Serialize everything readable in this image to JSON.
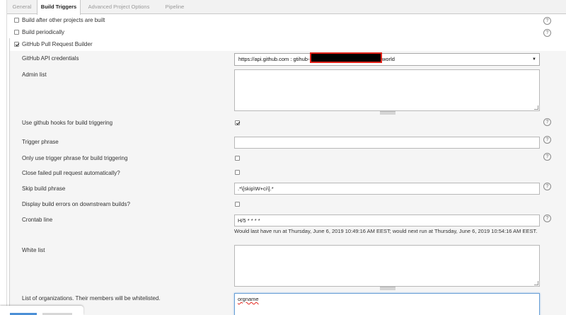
{
  "tabs": [
    {
      "label": "General"
    },
    {
      "label": "Build Triggers"
    },
    {
      "label": "Advanced Project Options"
    },
    {
      "label": "Pipeline"
    }
  ],
  "triggers": {
    "build_after_other": {
      "label": "Build after other projects are built",
      "checked": false
    },
    "build_periodically": {
      "label": "Build periodically",
      "checked": false
    },
    "ghprb": {
      "label": "GitHub Pull Request Builder",
      "checked": true
    }
  },
  "fields": {
    "api_credentials": {
      "label": "GitHub API credentials",
      "value_prefix": "https://api.github.com : gtihub-",
      "value_suffix": "world"
    },
    "admin_list": {
      "label": "Admin list",
      "value": ""
    },
    "use_hooks": {
      "label": "Use github hooks for build triggering",
      "checked": true
    },
    "trigger_phrase": {
      "label": "Trigger phrase",
      "value": ""
    },
    "only_trigger_phrase": {
      "label": "Only use trigger phrase for build triggering",
      "checked": false
    },
    "close_failed": {
      "label": "Close failed pull request automatically?",
      "checked": false
    },
    "skip_build_phrase": {
      "label": "Skip build phrase",
      "value": ".*\\[skip\\W+ci\\].*"
    },
    "display_errors": {
      "label": "Display build errors on downstream builds?",
      "checked": false
    },
    "crontab": {
      "label": "Crontab line",
      "value": "H/5 * * * *",
      "hint": "Would last have run at Thursday, June 6, 2019 10:49:16 AM EEST; would next run at Thursday, June 6, 2019 10:54:16 AM EEST."
    },
    "white_list": {
      "label": "White list",
      "value": ""
    },
    "org_list": {
      "label": "List of organizations. Their members will be whitelisted.",
      "value": "orgname"
    }
  },
  "help_glyph": "?",
  "select_arrow": "▼"
}
